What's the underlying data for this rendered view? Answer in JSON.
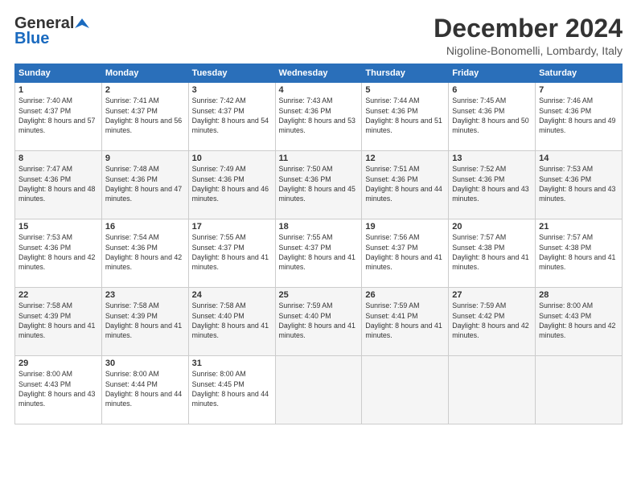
{
  "logo": {
    "general": "General",
    "blue": "Blue"
  },
  "header": {
    "month": "December 2024",
    "location": "Nigoline-Bonomelli, Lombardy, Italy"
  },
  "weekdays": [
    "Sunday",
    "Monday",
    "Tuesday",
    "Wednesday",
    "Thursday",
    "Friday",
    "Saturday"
  ],
  "weeks": [
    [
      {
        "day": "1",
        "sunrise": "7:40 AM",
        "sunset": "4:37 PM",
        "daylight": "8 hours and 57 minutes."
      },
      {
        "day": "2",
        "sunrise": "7:41 AM",
        "sunset": "4:37 PM",
        "daylight": "8 hours and 56 minutes."
      },
      {
        "day": "3",
        "sunrise": "7:42 AM",
        "sunset": "4:37 PM",
        "daylight": "8 hours and 54 minutes."
      },
      {
        "day": "4",
        "sunrise": "7:43 AM",
        "sunset": "4:36 PM",
        "daylight": "8 hours and 53 minutes."
      },
      {
        "day": "5",
        "sunrise": "7:44 AM",
        "sunset": "4:36 PM",
        "daylight": "8 hours and 51 minutes."
      },
      {
        "day": "6",
        "sunrise": "7:45 AM",
        "sunset": "4:36 PM",
        "daylight": "8 hours and 50 minutes."
      },
      {
        "day": "7",
        "sunrise": "7:46 AM",
        "sunset": "4:36 PM",
        "daylight": "8 hours and 49 minutes."
      }
    ],
    [
      {
        "day": "8",
        "sunrise": "7:47 AM",
        "sunset": "4:36 PM",
        "daylight": "8 hours and 48 minutes."
      },
      {
        "day": "9",
        "sunrise": "7:48 AM",
        "sunset": "4:36 PM",
        "daylight": "8 hours and 47 minutes."
      },
      {
        "day": "10",
        "sunrise": "7:49 AM",
        "sunset": "4:36 PM",
        "daylight": "8 hours and 46 minutes."
      },
      {
        "day": "11",
        "sunrise": "7:50 AM",
        "sunset": "4:36 PM",
        "daylight": "8 hours and 45 minutes."
      },
      {
        "day": "12",
        "sunrise": "7:51 AM",
        "sunset": "4:36 PM",
        "daylight": "8 hours and 44 minutes."
      },
      {
        "day": "13",
        "sunrise": "7:52 AM",
        "sunset": "4:36 PM",
        "daylight": "8 hours and 43 minutes."
      },
      {
        "day": "14",
        "sunrise": "7:53 AM",
        "sunset": "4:36 PM",
        "daylight": "8 hours and 43 minutes."
      }
    ],
    [
      {
        "day": "15",
        "sunrise": "7:53 AM",
        "sunset": "4:36 PM",
        "daylight": "8 hours and 42 minutes."
      },
      {
        "day": "16",
        "sunrise": "7:54 AM",
        "sunset": "4:36 PM",
        "daylight": "8 hours and 42 minutes."
      },
      {
        "day": "17",
        "sunrise": "7:55 AM",
        "sunset": "4:37 PM",
        "daylight": "8 hours and 41 minutes."
      },
      {
        "day": "18",
        "sunrise": "7:55 AM",
        "sunset": "4:37 PM",
        "daylight": "8 hours and 41 minutes."
      },
      {
        "day": "19",
        "sunrise": "7:56 AM",
        "sunset": "4:37 PM",
        "daylight": "8 hours and 41 minutes."
      },
      {
        "day": "20",
        "sunrise": "7:57 AM",
        "sunset": "4:38 PM",
        "daylight": "8 hours and 41 minutes."
      },
      {
        "day": "21",
        "sunrise": "7:57 AM",
        "sunset": "4:38 PM",
        "daylight": "8 hours and 41 minutes."
      }
    ],
    [
      {
        "day": "22",
        "sunrise": "7:58 AM",
        "sunset": "4:39 PM",
        "daylight": "8 hours and 41 minutes."
      },
      {
        "day": "23",
        "sunrise": "7:58 AM",
        "sunset": "4:39 PM",
        "daylight": "8 hours and 41 minutes."
      },
      {
        "day": "24",
        "sunrise": "7:58 AM",
        "sunset": "4:40 PM",
        "daylight": "8 hours and 41 minutes."
      },
      {
        "day": "25",
        "sunrise": "7:59 AM",
        "sunset": "4:40 PM",
        "daylight": "8 hours and 41 minutes."
      },
      {
        "day": "26",
        "sunrise": "7:59 AM",
        "sunset": "4:41 PM",
        "daylight": "8 hours and 41 minutes."
      },
      {
        "day": "27",
        "sunrise": "7:59 AM",
        "sunset": "4:42 PM",
        "daylight": "8 hours and 42 minutes."
      },
      {
        "day": "28",
        "sunrise": "8:00 AM",
        "sunset": "4:43 PM",
        "daylight": "8 hours and 42 minutes."
      }
    ],
    [
      {
        "day": "29",
        "sunrise": "8:00 AM",
        "sunset": "4:43 PM",
        "daylight": "8 hours and 43 minutes."
      },
      {
        "day": "30",
        "sunrise": "8:00 AM",
        "sunset": "4:44 PM",
        "daylight": "8 hours and 44 minutes."
      },
      {
        "day": "31",
        "sunrise": "8:00 AM",
        "sunset": "4:45 PM",
        "daylight": "8 hours and 44 minutes."
      },
      null,
      null,
      null,
      null
    ]
  ]
}
